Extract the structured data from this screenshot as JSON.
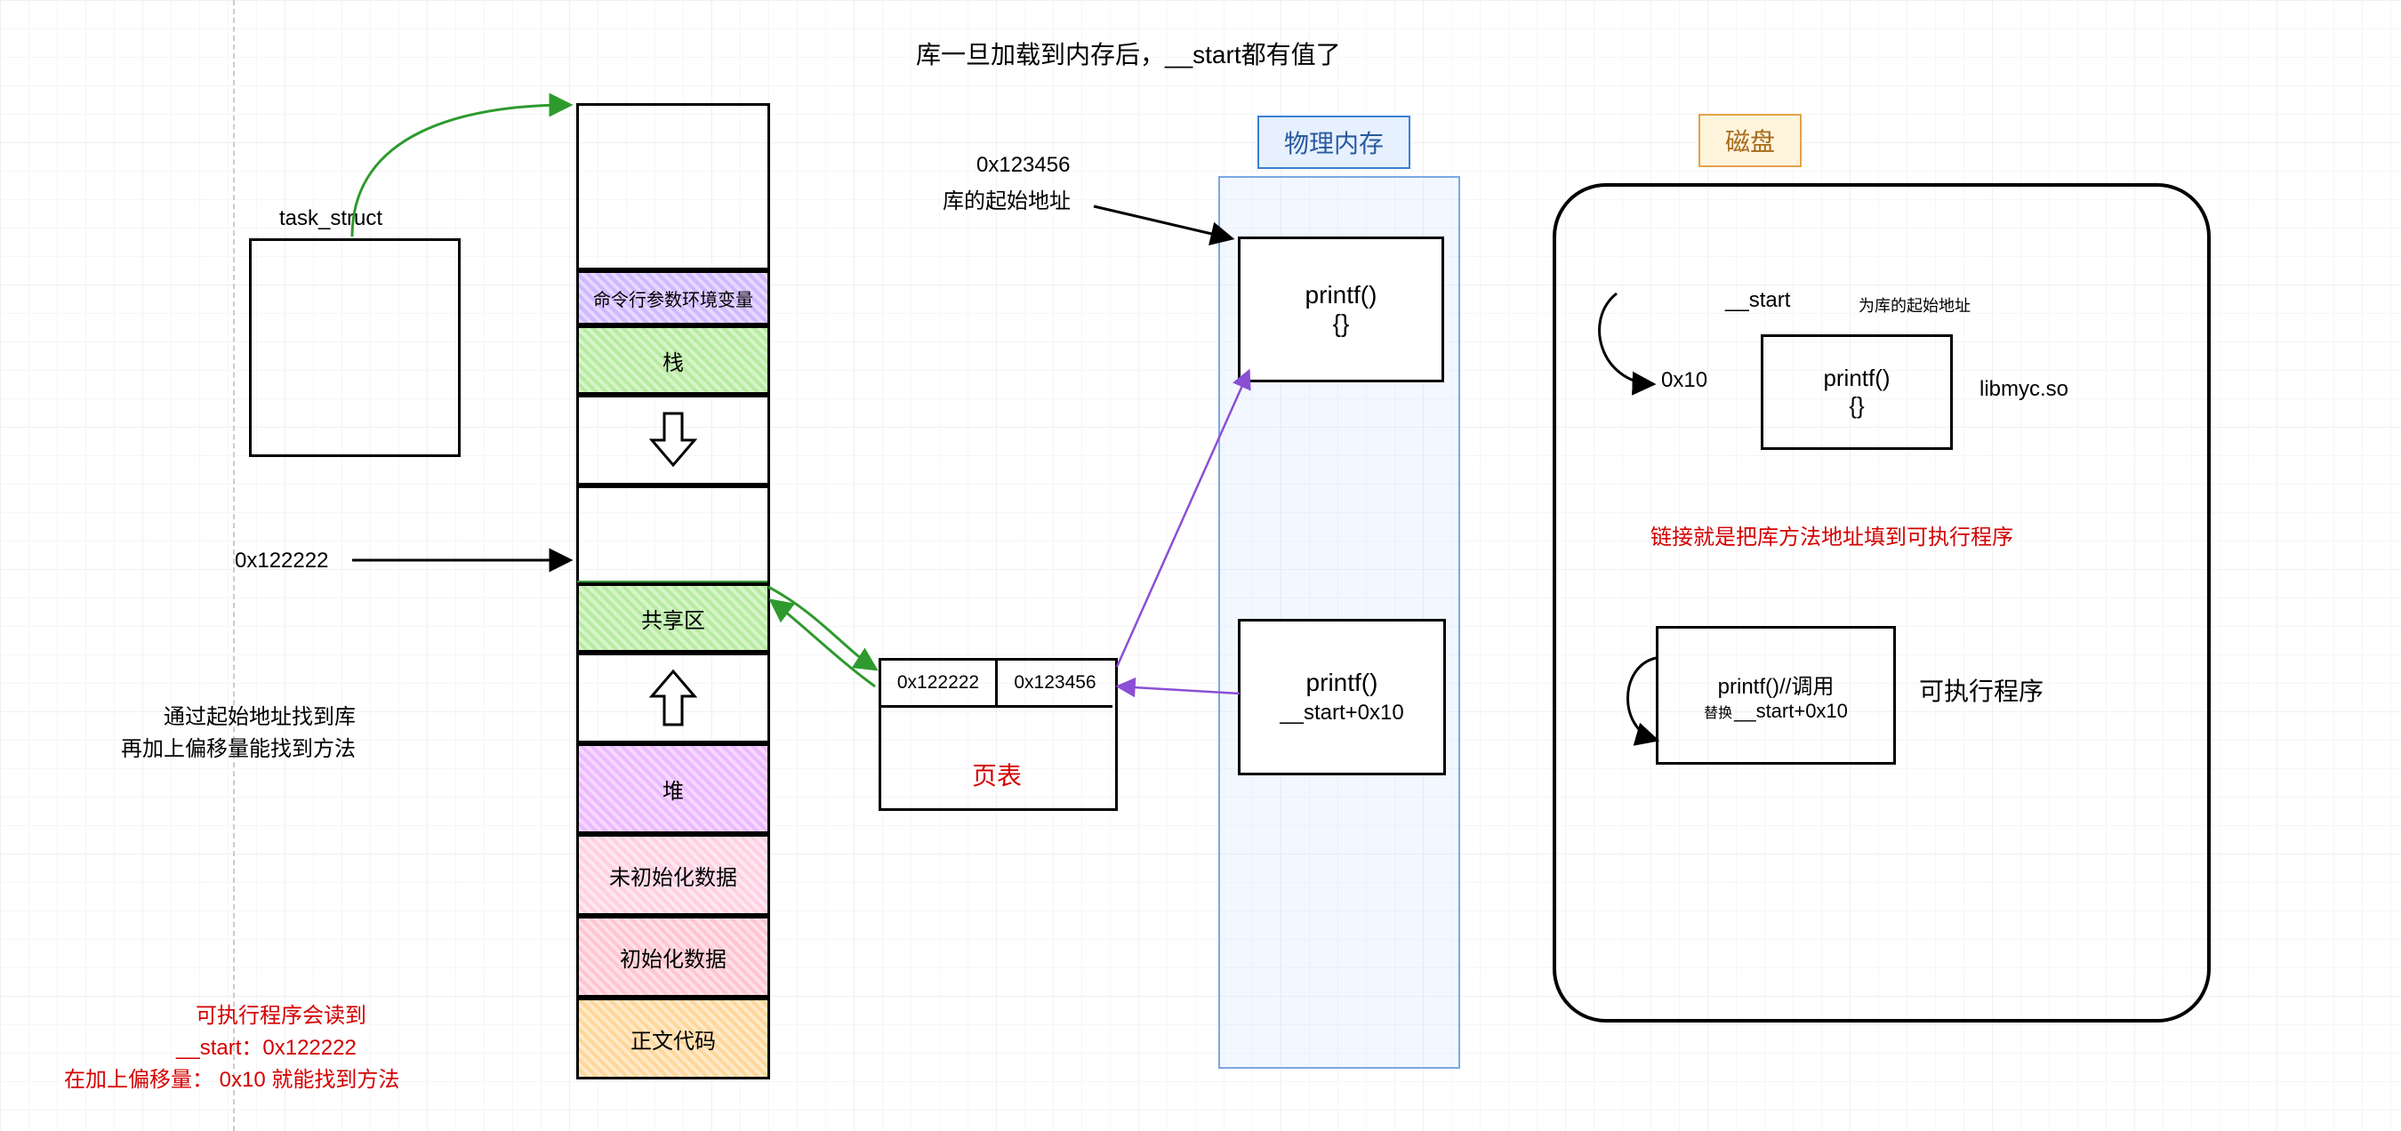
{
  "title": "库一旦加载到内存后，__start都有值了",
  "task_struct_label": "task_struct",
  "addr_shared": "0x122222",
  "note_find_lib_1": "通过起始地址找到库",
  "note_find_lib_2": "再加上偏移量能找到方法",
  "mem": {
    "empty_top": "",
    "cmdline": "命令行参数环境变量",
    "stack": "栈",
    "shared": "共享区",
    "heap": "堆",
    "uninit": "未初始化数据",
    "init": "初始化数据",
    "text": "正文代码"
  },
  "red_note_1": "可执行程序会读到",
  "red_note_2": "__start：0x122222",
  "red_note_3": "在加上偏移量：   0x10     就能找到方法",
  "pagetable": {
    "left": "0x122222",
    "right": "0x123456",
    "label": "页表"
  },
  "lib_addr_hex": "0x123456",
  "lib_addr_note": "库的起始地址",
  "phys_mem_title": "物理内存",
  "phys_mem_printf": "printf()",
  "phys_mem_printf_body": "{}",
  "phys_mem_printf2_line1": "printf()",
  "phys_mem_printf2_line2": "__start+0x10",
  "disk_title": "磁盘",
  "disk_start": "__start",
  "disk_start_note": "为库的起始地址",
  "disk_offset": "0x10",
  "disk_printf": "printf()",
  "disk_printf_body": "{}",
  "disk_libname": "libmyc.so",
  "disk_red_note": "链接就是把库方法地址填到可执行程序",
  "disk_exec_line1": "printf()//调用",
  "disk_exec_line2a": "替换",
  "disk_exec_line2b": "__start+0x10",
  "disk_exec_label": "可执行程序"
}
